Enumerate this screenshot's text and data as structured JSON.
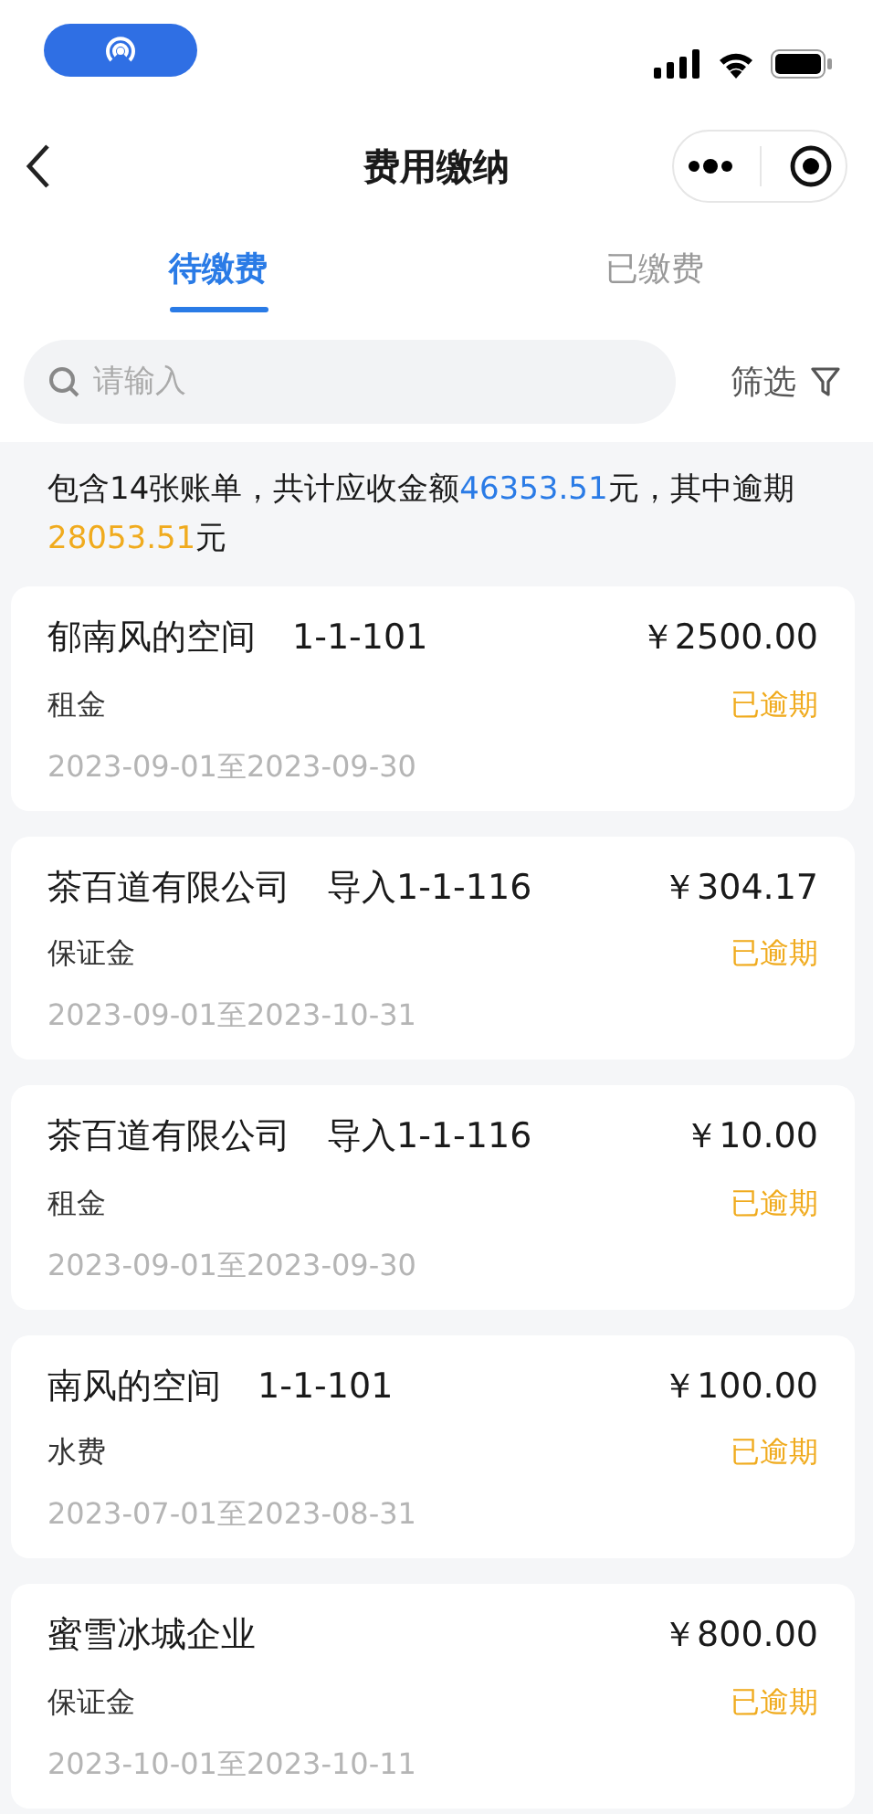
{
  "nav": {
    "title": "费用缴纳"
  },
  "tabs": [
    {
      "label": "待缴费",
      "selected": true
    },
    {
      "label": "已缴费",
      "selected": false
    }
  ],
  "search": {
    "placeholder": "请输入"
  },
  "filter": {
    "label": "筛选"
  },
  "summary": {
    "parts": [
      {
        "text": "包含14张账单，共计应收金额"
      },
      {
        "text": "46353.51",
        "color": "#2a7be6"
      },
      {
        "text": "元，其中逾期"
      },
      {
        "text": "28053.51",
        "color": "#f0ab1e"
      },
      {
        "text": "元"
      }
    ]
  },
  "bills": [
    {
      "name": "郁南风的空间",
      "unit": "1-1-101",
      "amount": "￥2500.00",
      "type": "租金",
      "status": "已逾期",
      "period": "2023-09-01至2023-09-30"
    },
    {
      "name": "茶百道有限公司",
      "unit": "导入1-1-116",
      "amount": "￥304.17",
      "type": "保证金",
      "status": "已逾期",
      "period": "2023-09-01至2023-10-31"
    },
    {
      "name": "茶百道有限公司",
      "unit": "导入1-1-116",
      "amount": "￥10.00",
      "type": "租金",
      "status": "已逾期",
      "period": "2023-09-01至2023-09-30"
    },
    {
      "name": "南风的空间",
      "unit": "1-1-101",
      "amount": "￥100.00",
      "type": "水费",
      "status": "已逾期",
      "period": "2023-07-01至2023-08-31"
    },
    {
      "name": "蜜雪冰城企业",
      "amount": "￥800.00",
      "type": "保证金",
      "status": "已逾期",
      "period": "2023-10-01至2023-10-11"
    }
  ]
}
